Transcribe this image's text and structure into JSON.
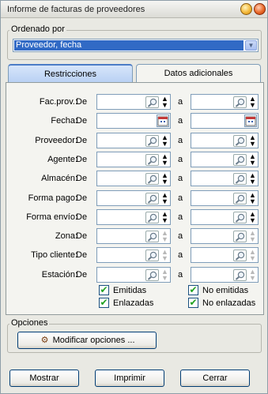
{
  "window": {
    "title": "Informe de facturas de proveedores"
  },
  "ordenado": {
    "legend": "Ordenado por",
    "selected": "Proveedor, fecha"
  },
  "tabs": [
    {
      "label": "Restricciones",
      "active": true
    },
    {
      "label": "Datos adicionales",
      "active": false
    }
  ],
  "range": {
    "from_label": "De",
    "to_label": "a"
  },
  "rows": [
    {
      "label": "Fac.prov.:",
      "kind": "search",
      "stepper": "active"
    },
    {
      "label": "Fecha:",
      "kind": "calendar"
    },
    {
      "label": "Proveedor:",
      "kind": "search",
      "stepper": "active"
    },
    {
      "label": "Agente:",
      "kind": "search",
      "stepper": "active"
    },
    {
      "label": "Almacén:",
      "kind": "search",
      "stepper": "active"
    },
    {
      "label": "Forma pago:",
      "kind": "search",
      "stepper": "active"
    },
    {
      "label": "Forma envío:",
      "kind": "search",
      "stepper": "active"
    },
    {
      "label": "Zona:",
      "kind": "search",
      "stepper": "disabled"
    },
    {
      "label": "Tipo cliente:",
      "kind": "search",
      "stepper": "disabled"
    },
    {
      "label": "Estación:",
      "kind": "search",
      "stepper": "disabled"
    }
  ],
  "checks": [
    {
      "label": "Emitidas",
      "checked": true
    },
    {
      "label": "No emitidas",
      "checked": true
    },
    {
      "label": "Enlazadas",
      "checked": true
    },
    {
      "label": "No enlazadas",
      "checked": true
    }
  ],
  "opciones": {
    "legend": "Opciones",
    "modify_button": "Modificar opciones ..."
  },
  "buttons": {
    "mostrar": "Mostrar",
    "imprimir": "Imprimir",
    "cerrar": "Cerrar"
  },
  "colors": {
    "accent": "#316ac5",
    "check": "#21a121"
  }
}
